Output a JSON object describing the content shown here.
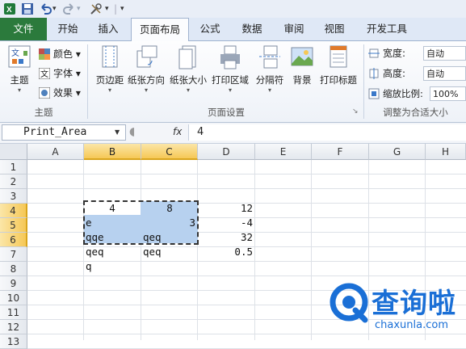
{
  "qat": {
    "sep": "|",
    "down1": "▾",
    "down2": "▾",
    "custom": "▾"
  },
  "tabs": [
    "文件",
    "开始",
    "插入",
    "页面布局",
    "公式",
    "数据",
    "审阅",
    "视图",
    "开发工具"
  ],
  "ribbon": {
    "theme_group": {
      "label": "主题",
      "themes_btn": "主题",
      "colors_btn": "颜色",
      "fonts_btn": "字体",
      "effects_btn": "效果"
    },
    "page_setup_group": {
      "label": "页面设置",
      "buttons": [
        "页边距",
        "纸张方向",
        "纸张大小",
        "打印区域",
        "分隔符",
        "背景",
        "打印标题"
      ]
    },
    "scale_group": {
      "label": "调整为合适大小",
      "width_label": "宽度:",
      "width_value": "自动",
      "height_label": "高度:",
      "height_value": "自动",
      "scale_label": "缩放比例:",
      "scale_value": "100%"
    }
  },
  "formula_bar": {
    "name_box": "Print_Area",
    "fx": "fx",
    "value": "4"
  },
  "columns": [
    "A",
    "B",
    "C",
    "D",
    "E",
    "F",
    "G",
    "H"
  ],
  "rows": [
    "1",
    "2",
    "3",
    "4",
    "5",
    "6",
    "7",
    "8",
    "9",
    "10",
    "11",
    "12",
    "13"
  ],
  "cells": {
    "B4": "4",
    "C4": "8",
    "D4": "12",
    "B5": "e",
    "C5": "3",
    "D5": "-4",
    "B6": "qqe",
    "C6": "qeq",
    "D6": "32",
    "B7": "qeq",
    "C7": "qeq",
    "D7": "0.5",
    "B8": "q"
  },
  "watermark": {
    "title": "查询啦",
    "domain": "chaxunla.com",
    "color": "#1a6fd6"
  }
}
